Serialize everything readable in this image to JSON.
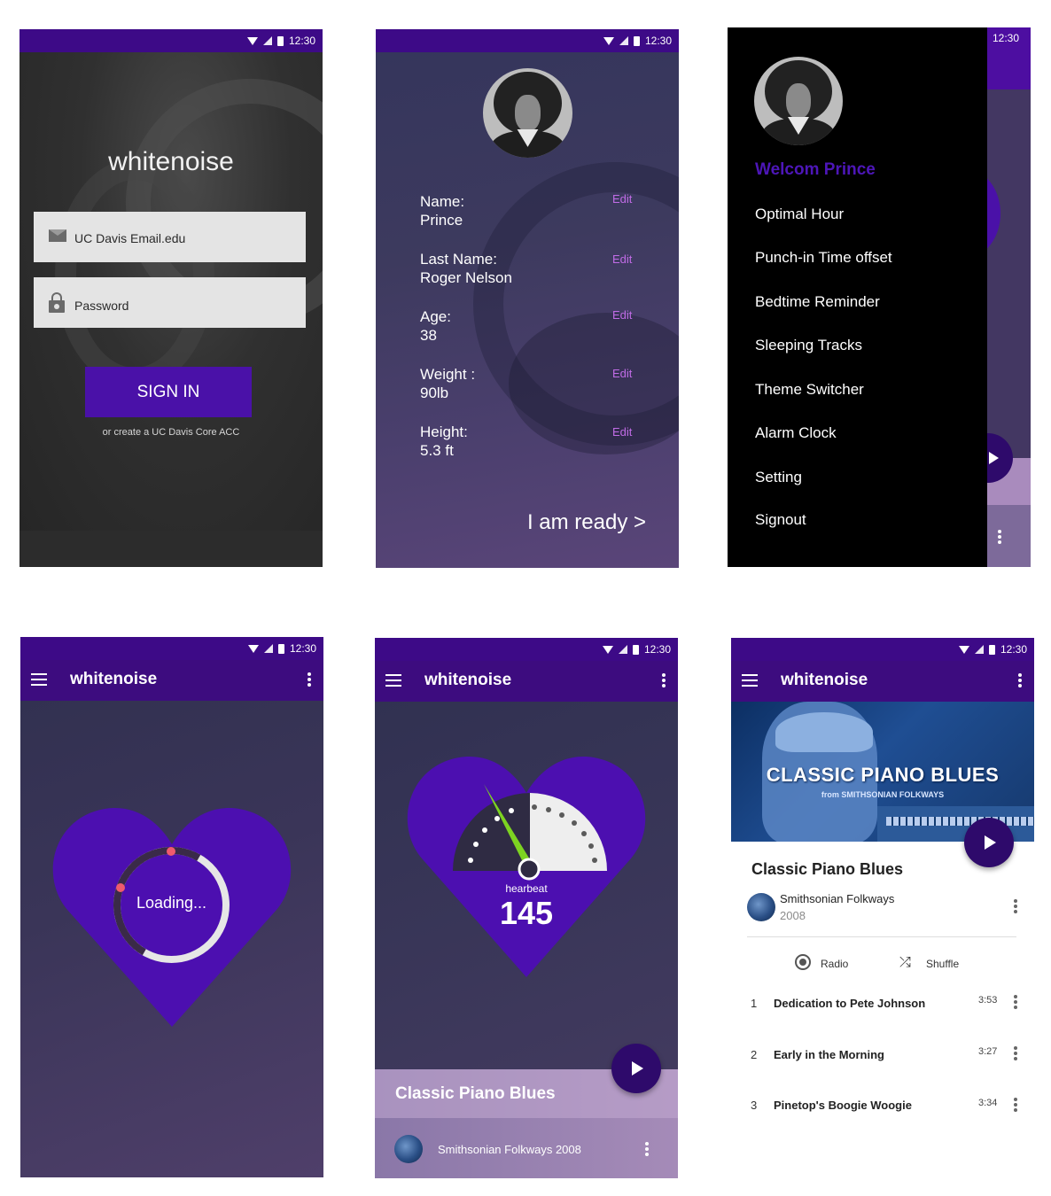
{
  "status_time": "12:30",
  "brand": "whitenoise",
  "login": {
    "email_placeholder": "UC Davis Email.edu",
    "password_placeholder": "Password",
    "signin_label": "SIGN IN",
    "create_link": "or create a UC Davis Core ACC"
  },
  "profile": {
    "fields": [
      {
        "label": "Name:",
        "value": "Prince",
        "edit": "Edit"
      },
      {
        "label": "Last Name:",
        "value": "Roger Nelson",
        "edit": "Edit"
      },
      {
        "label": "Age:",
        "value": "38",
        "edit": "Edit"
      },
      {
        "label": "Weight :",
        "value": "90lb",
        "edit": "Edit"
      },
      {
        "label": "Height:",
        "value": "5.3 ft",
        "edit": "Edit"
      }
    ],
    "ready_label": "I am ready >"
  },
  "drawer": {
    "welcome": "Welcom Prince",
    "items": [
      "Optimal Hour",
      "Punch-in Time offset",
      "Bedtime Reminder",
      "Sleeping Tracks",
      "Theme Switcher",
      "Alarm Clock",
      "Setting",
      "Signout"
    ]
  },
  "loading": {
    "text": "Loading...",
    "progress": 0.15
  },
  "heartbeat": {
    "label": "hearbeat",
    "value": "145",
    "now_playing_title": "Classic Piano Blues",
    "now_playing_sub": "Smithsonian Folkways 2008"
  },
  "album": {
    "cover_title": "CLASSIC PIANO BLUES",
    "cover_sub": "from SMITHSONIAN FOLKWAYS",
    "title": "Classic Piano Blues",
    "artist": "Smithsonian Folkways",
    "year": "2008",
    "radio_label": "Radio",
    "shuffle_label": "Shuffle",
    "tracks": [
      {
        "no": "1",
        "title": "Dedication to Pete Johnson",
        "duration": "3:53"
      },
      {
        "no": "2",
        "title": "Early in the Morning",
        "duration": "3:27"
      },
      {
        "no": "3",
        "title": "Pinetop's Boogie Woogie",
        "duration": "3:34"
      }
    ]
  },
  "colors": {
    "brand_purple": "#3d0a87",
    "accent_purple": "#4a11a8",
    "edit_pink": "#c16ce6",
    "loading_dot": "#ef5a6e",
    "gauge_needle": "#7dd321"
  },
  "icons": [
    "wifi-icon",
    "signal-icon",
    "battery-icon",
    "mail-icon",
    "lock-icon",
    "menu-icon",
    "more-vert-icon",
    "play-icon",
    "radio-icon",
    "shuffle-icon"
  ]
}
